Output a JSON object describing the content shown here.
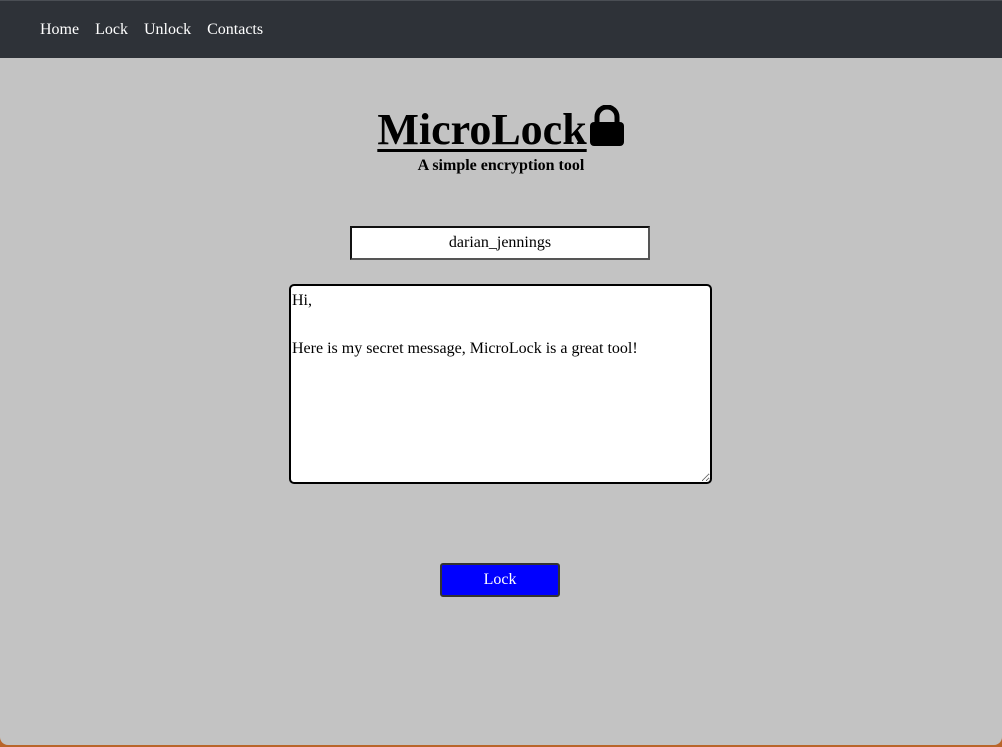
{
  "nav": {
    "items": [
      {
        "label": "Home"
      },
      {
        "label": "Lock"
      },
      {
        "label": "Unlock"
      },
      {
        "label": "Contacts"
      }
    ]
  },
  "header": {
    "title": "MicroLock",
    "subtitle": "A simple encryption tool",
    "icon": "lock-icon"
  },
  "form": {
    "recipient_value": "darian_jennings",
    "message_value": "Hi,\n\nHere is my secret message, MicroLock is a great tool!",
    "submit_label": "Lock"
  },
  "colors": {
    "navbar": "#2e3238",
    "background": "#c3c3c3",
    "button": "#0000ff"
  }
}
